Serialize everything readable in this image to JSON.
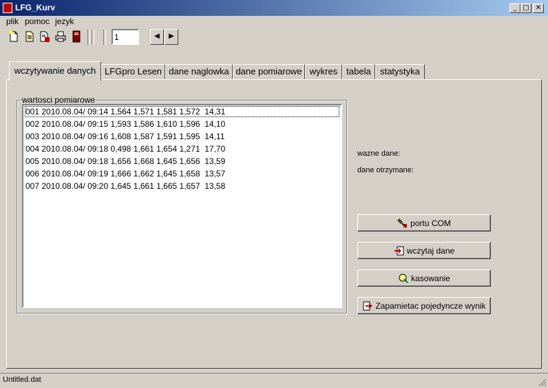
{
  "window": {
    "title": "LFG_Kurv"
  },
  "caption_buttons": {
    "minimize": "_",
    "maximize": "□",
    "close": "✕"
  },
  "menu": [
    {
      "label": "plik"
    },
    {
      "label": "pomoc"
    },
    {
      "label": "jezyk"
    }
  ],
  "toolbar": {
    "icons": [
      "new-document-icon",
      "open-document-icon",
      "save-document-icon",
      "print-icon",
      "exit-icon"
    ],
    "page_value": "1",
    "prev_label": "◀",
    "next_label": "▶"
  },
  "tabs": [
    {
      "label": "wczytywanie danych",
      "active": true
    },
    {
      "label": "LFGpro Lesen"
    },
    {
      "label": "dane naglowka"
    },
    {
      "label": "dane pomiarowe"
    },
    {
      "label": "wykres"
    },
    {
      "label": "tabela"
    },
    {
      "label": "statystyka"
    }
  ],
  "group": {
    "label": "wartosci pomiarowe",
    "rows": [
      "001 2010.08.04/ 09:14 1,564 1,571 1,581 1,572  14,31",
      "002 2010.08.04/ 09:15 1,593 1,586 1,610 1,596  14,10",
      "003 2010.08.04/ 09:16 1,608 1,587 1,591 1,595  14,11",
      "004 2010.08.04/ 09:18 0,498 1,661 1,654 1,271  17,70",
      "005 2010.08.04/ 09:18 1,656 1,668 1,645 1,656  13,59",
      "006 2010.08.04/ 09:19 1,666 1,662 1,645 1,658  13,57",
      "007 2010.08.04/ 09:20 1,645 1,661 1,665 1,657  13,58"
    ]
  },
  "info": {
    "important_label": "wazne dane:",
    "received_label": "dane otrzymane:"
  },
  "buttons": {
    "port": "portu COM",
    "load": "wczytaj dane",
    "clear": "kasowanie",
    "save_single": "Zapamietac pojedyncze wynik"
  },
  "status": {
    "text": "Untitled.dat"
  }
}
